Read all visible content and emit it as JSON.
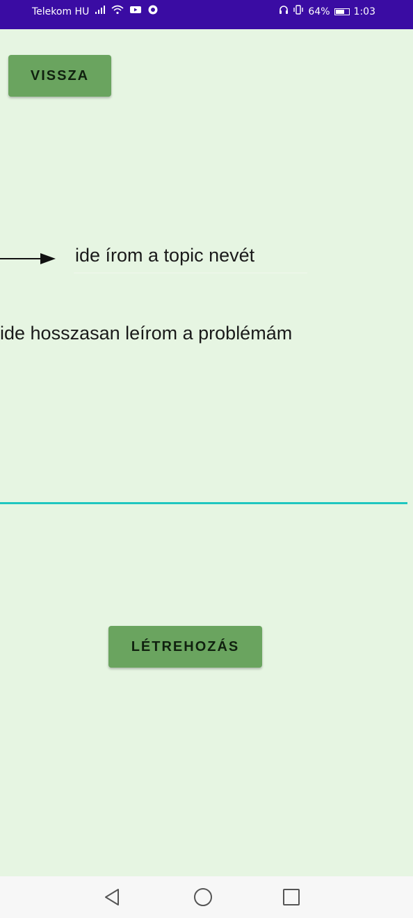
{
  "status_bar": {
    "carrier": "Telekom HU",
    "battery_percent": "64%",
    "time": "1:03",
    "icons": [
      "signal-icon",
      "wifi-icon",
      "youtube-icon",
      "app-notification-icon",
      "headphones-icon",
      "vibrate-icon",
      "battery-icon"
    ]
  },
  "toolbar": {
    "back_label": "VISSZA"
  },
  "form": {
    "topic_value": "ide írom a topic nevét",
    "description_value": "ide hosszasan leírom a problémám",
    "create_label": "LÉTREHOZÁS"
  },
  "colors": {
    "status_bar_bg": "#3a0ca3",
    "page_bg": "#e6f5e2",
    "button_bg": "#6aa45f",
    "focus_underline": "#1fc6c0"
  }
}
